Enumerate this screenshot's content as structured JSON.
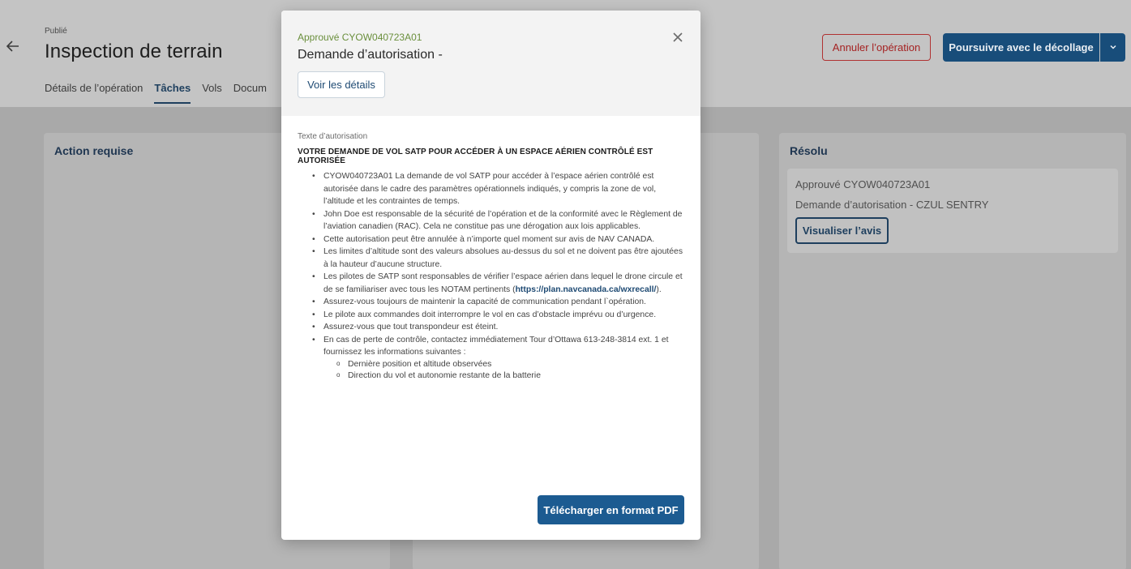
{
  "header": {
    "status": "Publié",
    "title": "Inspection de terrain",
    "tabs": [
      {
        "label": "Détails de l’opération"
      },
      {
        "label": "Tâches"
      },
      {
        "label": "Vols"
      },
      {
        "label": "Docum"
      }
    ],
    "cancel_label": "Annuler l’opération",
    "primary_label": "Poursuivre avec le décollage"
  },
  "columns": {
    "action_required": {
      "title": "Action requise"
    },
    "resolved": {
      "title": "Résolu",
      "card": {
        "status": "Approuvé CYOW040723A01",
        "name": "Demande d’autorisation - CZUL SENTRY",
        "button_label": "Visualiser l’avis"
      }
    }
  },
  "modal": {
    "status": "Approuvé CYOW040723A01",
    "title": "Demande d’autorisation -",
    "details_button": "Voir les détails",
    "text_label": "Texte d’autorisation",
    "heading": "VOTRE DEMANDE DE VOL SATP POUR ACCÉDER À UN ESPACE AÉRIEN CONTRÔLÉ EST AUTORISÉE",
    "items": [
      {
        "text": "CYOW040723A01 La demande de vol SATP pour accéder à l’espace aérien contrôlé est autorisée dans le cadre des paramètres opérationnels indiqués, y compris la zone de vol, l’altitude et les contraintes de temps."
      },
      {
        "text": "John Doe est responsable de la sécurité de l’opération et de la conformité avec le Règlement de l’aviation canadien (RAC). Cela ne constitue pas une dérogation aux lois applicables."
      },
      {
        "text": "Cette autorisation peut être annulée à n’importe quel moment sur avis de NAV CANADA."
      },
      {
        "text": "Les limites d’altitude sont des valeurs absolues au-dessus du sol et ne doivent pas être ajoutées à la hauteur d’aucune structure."
      },
      {
        "text_before": "Les pilotes de SATP sont responsables de vérifier l’espace aérien dans lequel le drone circule et de se familiariser avec tous les NOTAM pertinents (",
        "link": "https://plan.navcanada.ca/wxrecall/",
        "text_after": ")."
      },
      {
        "text": "Assurez-vous toujours de maintenir la capacité de communication pendant l`opération."
      },
      {
        "text": "Le pilote aux commandes doit interrompre le vol en cas d’obstacle imprévu ou d’urgence."
      },
      {
        "text": "Assurez-vous que tout transpondeur est éteint."
      },
      {
        "text": "En cas de perte de contrôle, contactez immédiatement Tour d’Ottawa 613-248-3814 ext. 1 et fournissez les informations suivantes :"
      }
    ],
    "subitems": [
      "Dernière position et altitude observées",
      "Direction du vol et autonomie restante de la batterie"
    ],
    "pdf_button": "Télécharger en format PDF"
  },
  "colors": {
    "overlay_header": "#c4c4c4",
    "overlay_body": "#a9a9a9",
    "primary": "#1c5b91",
    "approved_green": "#6a8f3c",
    "danger": "#a52222"
  },
  "icons": {
    "back": "back-arrow-icon",
    "close": "close-icon",
    "dropdown": "chevron-down-icon"
  }
}
